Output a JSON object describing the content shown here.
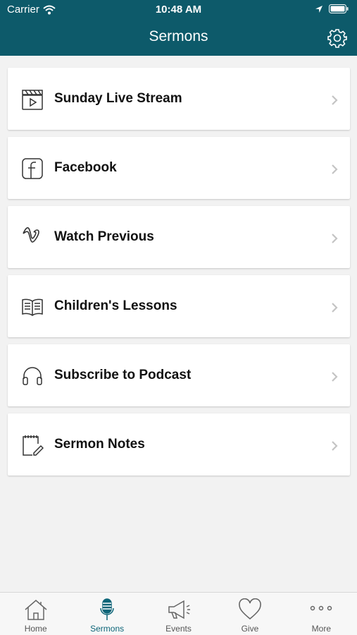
{
  "status_bar": {
    "carrier": "Carrier",
    "time": "10:48 AM"
  },
  "header": {
    "title": "Sermons"
  },
  "items": [
    {
      "label": "Sunday Live Stream",
      "icon": "clapperboard-icon"
    },
    {
      "label": "Facebook",
      "icon": "facebook-icon"
    },
    {
      "label": "Watch Previous",
      "icon": "vimeo-icon"
    },
    {
      "label": "Children's Lessons",
      "icon": "open-book-icon"
    },
    {
      "label": "Subscribe to Podcast",
      "icon": "headphones-icon"
    },
    {
      "label": "Sermon Notes",
      "icon": "notepad-pencil-icon"
    }
  ],
  "tabs": [
    {
      "label": "Home",
      "icon": "home-icon"
    },
    {
      "label": "Sermons",
      "icon": "microphone-icon",
      "active": true
    },
    {
      "label": "Events",
      "icon": "megaphone-icon"
    },
    {
      "label": "Give",
      "icon": "heart-icon"
    },
    {
      "label": "More",
      "icon": "more-dots-icon"
    }
  ],
  "colors": {
    "header": "#0d5a6a",
    "active_tab": "#0d6578"
  }
}
